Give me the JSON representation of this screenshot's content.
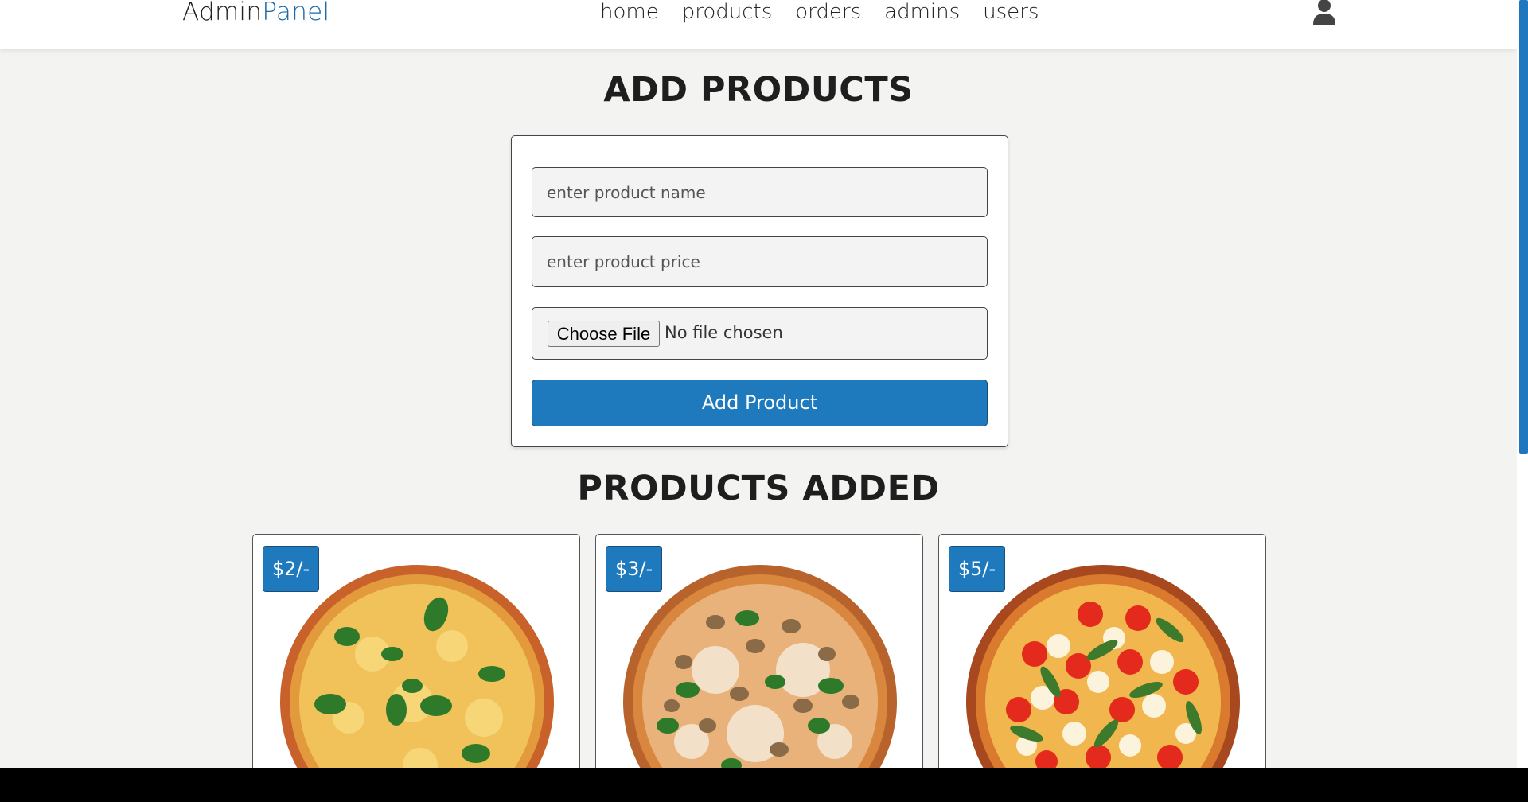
{
  "brand": {
    "part1": "Admin",
    "part2": "Panel"
  },
  "nav": [
    "home",
    "products",
    "orders",
    "admins",
    "users"
  ],
  "add_section": {
    "title": "ADD PRODUCTS",
    "name_placeholder": "enter product name",
    "price_placeholder": "enter product price",
    "choose_file_label": "Choose File",
    "file_status": "No file chosen",
    "submit_label": "Add Product"
  },
  "products_section": {
    "title": "PRODUCTS ADDED",
    "products": [
      {
        "price": "$2/-",
        "image": "margherita-cheese-pizza"
      },
      {
        "price": "$3/-",
        "image": "mushroom-basil-pizza"
      },
      {
        "price": "$5/-",
        "image": "tomato-mozzarella-arugula-pizza"
      }
    ]
  },
  "colors": {
    "accent": "#1f79bd",
    "brand_accent": "#1b69a8",
    "background": "#f3f3f2"
  },
  "icons": {
    "user": "user-icon"
  }
}
